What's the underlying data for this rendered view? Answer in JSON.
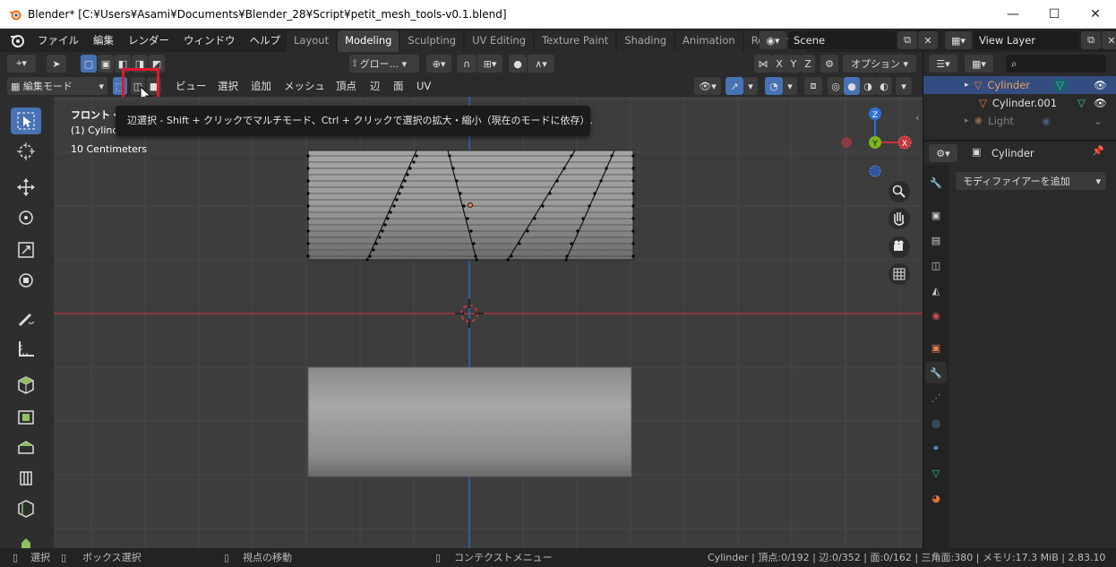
{
  "window": {
    "title": "Blender* [C:¥Users¥Asami¥Documents¥Blender_28¥Script¥petit_mesh_tools-v0.1.blend]",
    "minimize": "—",
    "maximize": "☐",
    "close": "✕"
  },
  "menu": {
    "items": [
      "ファイル",
      "編集",
      "レンダー",
      "ウィンドウ",
      "ヘルプ"
    ]
  },
  "workspaces": {
    "tabs": [
      "Layout",
      "Modeling",
      "Sculpting",
      "UV Editing",
      "Texture Paint",
      "Shading",
      "Animation",
      "Renderin"
    ],
    "active": "Modeling"
  },
  "scene": {
    "name": "Scene"
  },
  "view_layer": {
    "name": "View Layer"
  },
  "header": {
    "orientation": "グロー...",
    "options": "オプション",
    "axes": [
      "X",
      "Y",
      "Z"
    ],
    "mode": "編集モード",
    "menus": [
      "ビュー",
      "選択",
      "追加",
      "メッシュ",
      "頂点",
      "辺",
      "面",
      "UV"
    ]
  },
  "viewport": {
    "view_name": "フロント・",
    "object_line": "(1) Cylinder",
    "scale": "10 Centimeters"
  },
  "tooltip": {
    "text": "辺選択 - Shift + クリックでマルチモード、Ctrl + クリックで選択の拡大・縮小（現在のモードに依存）."
  },
  "outliner": {
    "items": [
      {
        "name": "Cylinder",
        "selected": true
      },
      {
        "name": "Cylinder.001",
        "selected": false
      },
      {
        "name": "Light",
        "selected": false,
        "dimmed": true
      }
    ]
  },
  "properties": {
    "object_name": "Cylinder",
    "add_modifier": "モディファイアーを追加"
  },
  "status": {
    "select": "選択",
    "box_select": "ボックス選択",
    "move_view": "視点の移動",
    "context_menu": "コンテクストメニュー",
    "stats": "Cylinder | 頂点:0/192 | 辺:0/352 | 面:0/162 | 三角面:380 | メモリ:17.3 MiB | 2.83.10"
  },
  "colors": {
    "accent": "#4772b3",
    "highlight_box": "#e0192b",
    "axis_x": "#c8323c",
    "axis_y": "#7bb51f",
    "axis_z": "#2f6fd6",
    "object_orange": "#e6804d"
  }
}
